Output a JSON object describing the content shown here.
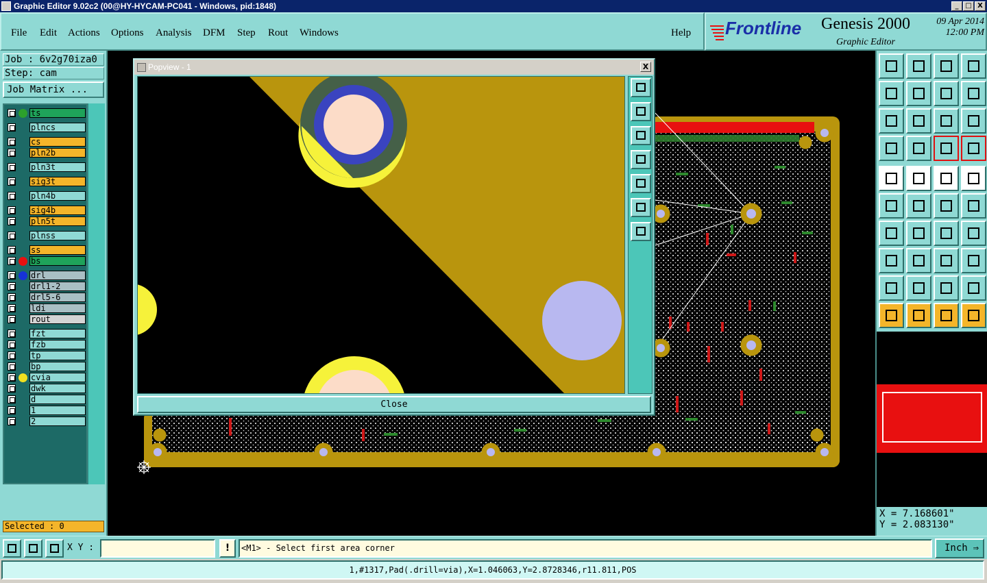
{
  "window": {
    "title": "Graphic Editor 9.02c2 (00@HY-HYCAM-PC041 - Windows, pid:1848)",
    "controls": [
      "_",
      "□",
      "X"
    ]
  },
  "menu": [
    "File",
    "Edit",
    "Actions",
    "Options",
    "Analysis",
    "DFM",
    "Step",
    "Rout",
    "Windows"
  ],
  "help_label": "Help",
  "brand": {
    "logo": "Frontline",
    "product": "Genesis 2000",
    "subtitle": "Graphic Editor",
    "date": "09 Apr 2014",
    "time": "12:00 PM"
  },
  "job": {
    "job_line": "Job : 6v2g70iza0",
    "step_line": "Step: cam",
    "job_matrix": "Job Matrix ..."
  },
  "layers": [
    {
      "name": "ts",
      "color": "#1fa35a",
      "dot": "#2ca02c"
    },
    {
      "name": "plncs",
      "color": "#8fd9d4",
      "dot": null
    },
    {
      "name": "cs",
      "color": "#f4b52a",
      "dot": null
    },
    {
      "name": "pln2b",
      "color": "#f4b52a",
      "dot": null
    },
    {
      "name": "pln3t",
      "color": "#8fd9d4",
      "dot": null
    },
    {
      "name": "sig3t",
      "color": "#f4b52a",
      "dot": null
    },
    {
      "name": "pln4b",
      "color": "#8fd9d4",
      "dot": null
    },
    {
      "name": "sig4b",
      "color": "#f4b52a",
      "dot": null
    },
    {
      "name": "pln5t",
      "color": "#f4b52a",
      "dot": null
    },
    {
      "name": "plnss",
      "color": "#8fd9d4",
      "dot": null
    },
    {
      "name": "ss",
      "color": "#f4b52a",
      "dot": null
    },
    {
      "name": "bs",
      "color": "#1fa35a",
      "dot": "#e81010"
    },
    {
      "name": "drl",
      "color": "#a9bfc4",
      "dot": "#1633d8"
    },
    {
      "name": "drl1-2",
      "color": "#a9bfc4",
      "dot": null
    },
    {
      "name": "drl5-6",
      "color": "#a9bfc4",
      "dot": null
    },
    {
      "name": "ldi",
      "color": "#a9bfc4",
      "dot": null
    },
    {
      "name": "rout",
      "color": "#d4d4d4",
      "dot": null
    },
    {
      "name": "fzt",
      "color": "#8fd9d4",
      "dot": null
    },
    {
      "name": "fzb",
      "color": "#8fd9d4",
      "dot": null
    },
    {
      "name": "tp",
      "color": "#8fd9d4",
      "dot": null
    },
    {
      "name": "bp",
      "color": "#8fd9d4",
      "dot": null
    },
    {
      "name": "cvia",
      "color": "#8fd9d4",
      "dot": "#f0e020"
    },
    {
      "name": "dwk",
      "color": "#8fd9d4",
      "dot": null
    },
    {
      "name": "d",
      "color": "#8fd9d4",
      "dot": null
    },
    {
      "name": "1",
      "color": "#8fd9d4",
      "dot": null
    },
    {
      "name": "2",
      "color": "#8fd9d4",
      "dot": null
    }
  ],
  "selected": "Selected : 0",
  "popview": {
    "title": "Popview - 1",
    "close_label": "Close",
    "close_x": "X"
  },
  "coords": {
    "x": "X = 7.168601\"",
    "y": "Y = 2.083130\""
  },
  "bottom": {
    "xy_label": "X Y :",
    "xy_value": "",
    "exclaim": "!",
    "prompt": "<M1> - Select first area corner",
    "unit": "Inch"
  },
  "status_line": "1,#1317,Pad(.drill=via),X=1.046063,Y=2.8728346,r11.811,POS",
  "colors": {
    "panel": "#8fd9d4",
    "gold": "#b9950d",
    "red": "#e81010",
    "via_fill": "#b8b8f0",
    "pad_peach": "#fcdcc8",
    "pad_blue": "#3a44c0",
    "pad_green": "#456048",
    "pad_yellow": "#f6f23a"
  }
}
